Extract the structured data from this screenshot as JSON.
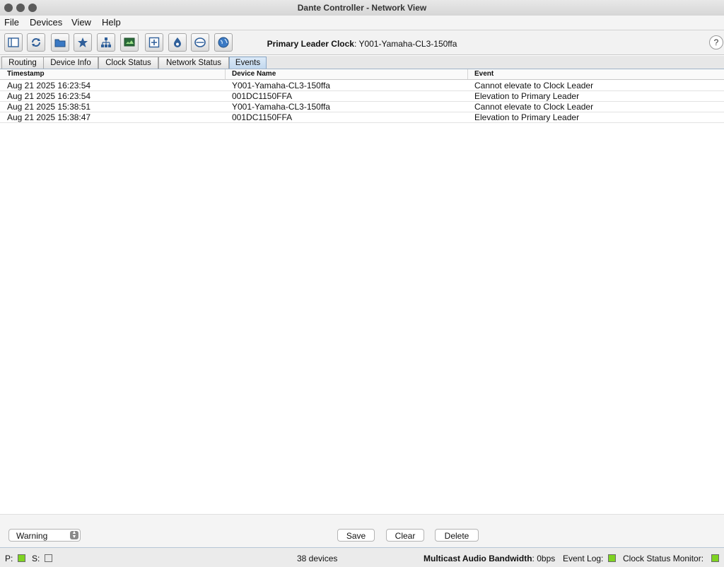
{
  "window": {
    "title": "Dante Controller - Network View"
  },
  "menu": {
    "items": [
      "File",
      "Devices",
      "View",
      "Help"
    ]
  },
  "toolbar": {
    "icons": [
      "sidebar-icon",
      "refresh-icon",
      "folder-icon",
      "star-icon",
      "network-icon",
      "monitor-icon",
      "plus-box-icon",
      "drop-icon",
      "ellipse-icon",
      "globe-icon"
    ],
    "clock_label": "Primary Leader Clock",
    "clock_value": "Y001-Yamaha-CL3-150ffa",
    "help_label": "?"
  },
  "tabs": [
    {
      "label": "Routing",
      "active": false
    },
    {
      "label": "Device Info",
      "active": false
    },
    {
      "label": "Clock Status",
      "active": false
    },
    {
      "label": "Network Status",
      "active": false
    },
    {
      "label": "Events",
      "active": true
    }
  ],
  "table": {
    "headers": [
      "Timestamp",
      "Device Name",
      "Event"
    ],
    "rows": [
      [
        "Aug 21 2025 16:23:54",
        "Y001-Yamaha-CL3-150ffa",
        "Cannot elevate to Clock Leader"
      ],
      [
        "Aug 21 2025 16:23:54",
        "001DC1150FFA",
        "Elevation to Primary Leader"
      ],
      [
        "Aug 21 2025 15:38:51",
        "Y001-Yamaha-CL3-150ffa",
        "Cannot elevate to Clock Leader"
      ],
      [
        "Aug 21 2025 15:38:47",
        "001DC1150FFA",
        "Elevation to Primary Leader"
      ]
    ]
  },
  "controls": {
    "filter_value": "Warning",
    "save_label": "Save",
    "clear_label": "Clear",
    "delete_label": "Delete"
  },
  "status": {
    "p_label": "P:",
    "s_label": "S:",
    "device_count": "38 devices",
    "bandwidth_label": "Multicast Audio Bandwidth",
    "bandwidth_value": "0bps",
    "event_log_label": "Event Log:",
    "clock_monitor_label": "Clock Status Monitor:"
  },
  "colors": {
    "indicator_green": "#7ed321",
    "tab_active": "#c2d8ee"
  }
}
